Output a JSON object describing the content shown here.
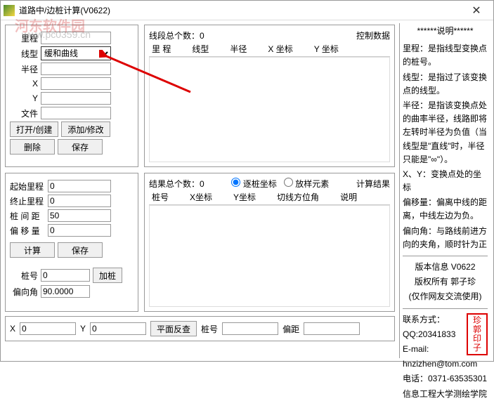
{
  "window": {
    "title": "道路中/边桩计算(V0622)"
  },
  "watermark": {
    "text1": "河东软件园",
    "text2": "www.pc0359.cn"
  },
  "panel1": {
    "licheng": "里程",
    "xianxing": "线型",
    "xianxing_value": "缓和曲线",
    "banjing": "半径",
    "x": "X",
    "y": "Y",
    "wenjian": "文件",
    "open_create": "打开/创建",
    "add_modify": "添加/修改",
    "delete": "删除",
    "save": "保存"
  },
  "listpanel": {
    "count_label": "线段总个数：",
    "count": "0",
    "control_data": "控制数据",
    "headers": [
      "里   程",
      "线型",
      "半径",
      "X 坐标",
      "Y 坐标"
    ]
  },
  "panel2": {
    "start_licheng": "起始里程",
    "end_licheng": "终止里程",
    "zhuangjianju": "桩 间 距",
    "pianyiliang": "偏 移 量",
    "start_val": "0",
    "end_val": "0",
    "jianju_val": "50",
    "pianyi_val": "0",
    "calc": "计算",
    "save": "保存",
    "zhuanghao": "桩号",
    "zhuanghao_val": "0",
    "pianxiangjiao": "偏向角",
    "pianxiangjiao_val": "90.0000",
    "jiazhuang": "加桩"
  },
  "resultpanel": {
    "count_label": "结果总个数：",
    "count": "0",
    "result_label": "计算结果",
    "radio1": "逐桩坐标",
    "radio2": "放样元素",
    "headers": [
      "桩号",
      "X坐标",
      "Y坐标",
      "切线方位角",
      "说明"
    ]
  },
  "bottombar": {
    "x": "X",
    "y": "Y",
    "x_val": "0",
    "y_val": "0",
    "pingmian": "平面反查",
    "zhuanghao": "桩号",
    "pianju": "偏距"
  },
  "side": {
    "title": "******说明******",
    "p1": "里程：是指线型变换点的桩号。",
    "p2": "线型：是指过了该变换点的线型。",
    "p3": "半径：是指该变换点处的曲率半径，线路即将左转时半径为负值（当线型是\"直线\"时，半径只能是\"∞\"）。",
    "p4": "X、Y：变换点处的坐标",
    "p5": "偏移量：偏离中线的距离，中线左边为负。",
    "p6": "偏向角：与路线前进方向的夹角，顺时针为正",
    "v1": "版本信息   V0622",
    "v2": "版权所有   郭子珍",
    "v3": "(仅作网友交流使用)",
    "c1": "联系方式：",
    "c2": "QQ:20341833",
    "c3": "E-mail:",
    "c4": "hnzizhen@tom.com",
    "c5": "电话：0371-63535301",
    "c6": "信息工程大学测绘学院",
    "stamp1": "珍郭",
    "stamp2": "印子"
  }
}
